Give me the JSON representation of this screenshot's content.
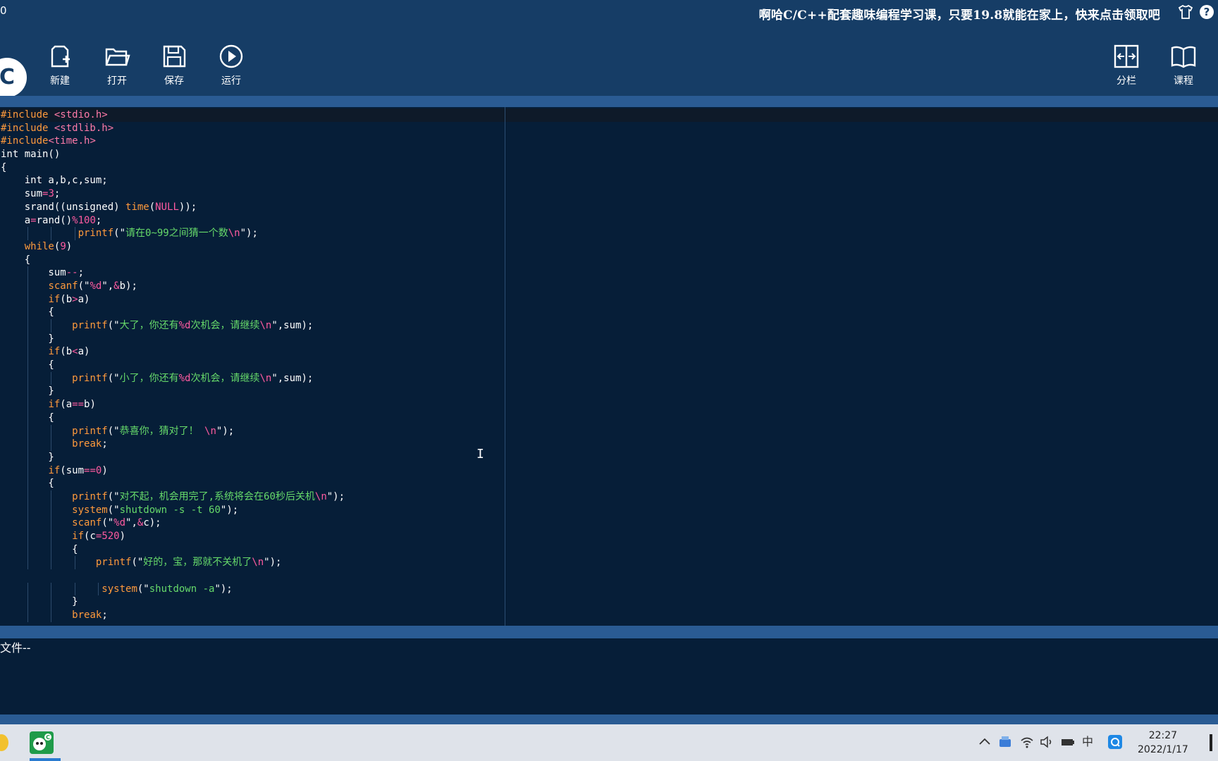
{
  "app": {
    "title_fragment": "0",
    "promo": "啊哈C/C++配套趣味编程学习课，只要19.8就能在家上，快来点击领取吧"
  },
  "toolbar": {
    "new_label": "新建",
    "open_label": "打开",
    "save_label": "保存",
    "run_label": "运行",
    "split_label": "分栏",
    "course_label": "课程"
  },
  "output": {
    "text": "文件--"
  },
  "taskbar": {
    "time": "22:27",
    "date": "2022/1/17",
    "ime": "中"
  },
  "colors": {
    "background": "#0d2a47",
    "toolbar": "#163d66",
    "editor": "#061e38",
    "keyword": "#ff9a3c",
    "string": "#66d96a",
    "number": "#ff5aa0",
    "strip": "#2a5b93"
  },
  "code_lines": [
    [
      [
        "#include ",
        "pre"
      ],
      [
        "<stdio.h>",
        "inc"
      ]
    ],
    [
      [
        "#include ",
        "pre"
      ],
      [
        "<stdlib.h>",
        "inc"
      ]
    ],
    [
      [
        "#include",
        "pre"
      ],
      [
        "<time.h>",
        "inc"
      ]
    ],
    [
      [
        "int main()",
        ""
      ]
    ],
    [
      [
        "{",
        ""
      ]
    ],
    [
      [
        "    int a,b,c,sum;",
        ""
      ]
    ],
    [
      [
        "    sum",
        ""
      ],
      [
        "=",
        "op"
      ],
      [
        "3",
        "num"
      ],
      [
        ";",
        ""
      ]
    ],
    [
      [
        "    srand((unsigned) ",
        ""
      ],
      [
        "time",
        "kw"
      ],
      [
        "(",
        ""
      ],
      [
        "NULL",
        "num"
      ],
      [
        "));",
        ""
      ]
    ],
    [
      [
        "    a",
        ""
      ],
      [
        "=",
        "op"
      ],
      [
        "rand()",
        ""
      ],
      [
        "%",
        "op"
      ],
      [
        "100",
        "num"
      ],
      [
        ";",
        ""
      ]
    ],
    [
      [
        "             ",
        ""
      ],
      [
        "printf",
        "kw"
      ],
      [
        "(\"",
        ""
      ],
      [
        "请在0~99之间猜一个数",
        "str"
      ],
      [
        "\\n",
        "esc"
      ],
      [
        "\");",
        ""
      ]
    ],
    [
      [
        "    ",
        ""
      ],
      [
        "while",
        "kw"
      ],
      [
        "(",
        ""
      ],
      [
        "9",
        "num"
      ],
      [
        ")",
        ""
      ]
    ],
    [
      [
        "    {",
        ""
      ]
    ],
    [
      [
        "        sum",
        ""
      ],
      [
        "--",
        "op"
      ],
      [
        ";",
        ""
      ]
    ],
    [
      [
        "        ",
        ""
      ],
      [
        "scanf",
        "kw"
      ],
      [
        "(\"",
        ""
      ],
      [
        "%d",
        "esc"
      ],
      [
        "\",",
        ""
      ],
      [
        "&",
        "op"
      ],
      [
        "b);",
        ""
      ]
    ],
    [
      [
        "        ",
        ""
      ],
      [
        "if",
        "kw"
      ],
      [
        "(b",
        ""
      ],
      [
        ">",
        "op"
      ],
      [
        "a)",
        ""
      ]
    ],
    [
      [
        "        {",
        ""
      ]
    ],
    [
      [
        "            ",
        ""
      ],
      [
        "printf",
        "kw"
      ],
      [
        "(\"",
        ""
      ],
      [
        "大了，你还有",
        "str"
      ],
      [
        "%d",
        "esc"
      ],
      [
        "次机会，请继续",
        "str"
      ],
      [
        "\\n",
        "esc"
      ],
      [
        "\",sum);",
        ""
      ]
    ],
    [
      [
        "        }",
        ""
      ]
    ],
    [
      [
        "        ",
        ""
      ],
      [
        "if",
        "kw"
      ],
      [
        "(b",
        ""
      ],
      [
        "<",
        "op"
      ],
      [
        "a)",
        ""
      ]
    ],
    [
      [
        "        {",
        ""
      ]
    ],
    [
      [
        "            ",
        ""
      ],
      [
        "printf",
        "kw"
      ],
      [
        "(\"",
        ""
      ],
      [
        "小了，你还有",
        "str"
      ],
      [
        "%d",
        "esc"
      ],
      [
        "次机会，请继续",
        "str"
      ],
      [
        "\\n",
        "esc"
      ],
      [
        "\",sum);",
        ""
      ]
    ],
    [
      [
        "        }",
        ""
      ]
    ],
    [
      [
        "        ",
        ""
      ],
      [
        "if",
        "kw"
      ],
      [
        "(a",
        ""
      ],
      [
        "==",
        "op"
      ],
      [
        "b)",
        ""
      ]
    ],
    [
      [
        "        {",
        ""
      ]
    ],
    [
      [
        "            ",
        ""
      ],
      [
        "printf",
        "kw"
      ],
      [
        "(\"",
        ""
      ],
      [
        "恭喜你，猜对了！",
        "str"
      ],
      [
        " \\n",
        "esc"
      ],
      [
        "\");",
        ""
      ]
    ],
    [
      [
        "            ",
        ""
      ],
      [
        "break",
        "kw"
      ],
      [
        ";",
        ""
      ]
    ],
    [
      [
        "        }",
        ""
      ]
    ],
    [
      [
        "        ",
        ""
      ],
      [
        "if",
        "kw"
      ],
      [
        "(sum",
        ""
      ],
      [
        "==",
        "op"
      ],
      [
        "0",
        "num"
      ],
      [
        ")",
        ""
      ]
    ],
    [
      [
        "        {",
        ""
      ]
    ],
    [
      [
        "            ",
        ""
      ],
      [
        "printf",
        "kw"
      ],
      [
        "(\"",
        ""
      ],
      [
        "对不起，机会用完了,系统将会在60秒后关机",
        "str"
      ],
      [
        "\\n",
        "esc"
      ],
      [
        "\");",
        ""
      ]
    ],
    [
      [
        "            ",
        ""
      ],
      [
        "system",
        "kw"
      ],
      [
        "(\"",
        ""
      ],
      [
        "shutdown -s -t 60",
        "str"
      ],
      [
        "\");",
        ""
      ]
    ],
    [
      [
        "            ",
        ""
      ],
      [
        "scanf",
        "kw"
      ],
      [
        "(\"",
        ""
      ],
      [
        "%d",
        "esc"
      ],
      [
        "\",",
        ""
      ],
      [
        "&",
        "op"
      ],
      [
        "c);",
        ""
      ]
    ],
    [
      [
        "            ",
        ""
      ],
      [
        "if",
        "kw"
      ],
      [
        "(c",
        ""
      ],
      [
        "=",
        "op"
      ],
      [
        "520",
        "num"
      ],
      [
        ")",
        ""
      ]
    ],
    [
      [
        "            {",
        ""
      ]
    ],
    [
      [
        "                ",
        ""
      ],
      [
        "printf",
        "kw"
      ],
      [
        "(\"",
        ""
      ],
      [
        "好的，宝，那就不关机了",
        "str"
      ],
      [
        "\\n",
        "esc"
      ],
      [
        "\");",
        ""
      ]
    ],
    [
      [
        "",
        ""
      ]
    ],
    [
      [
        "                 ",
        ""
      ],
      [
        "system",
        "kw"
      ],
      [
        "(\"",
        ""
      ],
      [
        "shutdown -a",
        "str"
      ],
      [
        "\");",
        ""
      ]
    ],
    [
      [
        "            }",
        ""
      ]
    ],
    [
      [
        "            ",
        ""
      ],
      [
        "break",
        "kw"
      ],
      [
        ";",
        ""
      ]
    ]
  ]
}
